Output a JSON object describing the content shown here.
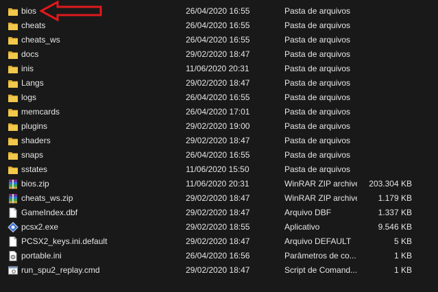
{
  "files": [
    {
      "name": "bios",
      "date": "26/04/2020 16:55",
      "type": "Pasta de arquivos",
      "size": "",
      "icon": "folder-icon"
    },
    {
      "name": "cheats",
      "date": "26/04/2020 16:55",
      "type": "Pasta de arquivos",
      "size": "",
      "icon": "folder-icon"
    },
    {
      "name": "cheats_ws",
      "date": "26/04/2020 16:55",
      "type": "Pasta de arquivos",
      "size": "",
      "icon": "folder-icon"
    },
    {
      "name": "docs",
      "date": "29/02/2020 18:47",
      "type": "Pasta de arquivos",
      "size": "",
      "icon": "folder-icon"
    },
    {
      "name": "inis",
      "date": "11/06/2020 20:31",
      "type": "Pasta de arquivos",
      "size": "",
      "icon": "folder-icon"
    },
    {
      "name": "Langs",
      "date": "29/02/2020 18:47",
      "type": "Pasta de arquivos",
      "size": "",
      "icon": "folder-icon"
    },
    {
      "name": "logs",
      "date": "26/04/2020 16:55",
      "type": "Pasta de arquivos",
      "size": "",
      "icon": "folder-icon"
    },
    {
      "name": "memcards",
      "date": "26/04/2020 17:01",
      "type": "Pasta de arquivos",
      "size": "",
      "icon": "folder-icon"
    },
    {
      "name": "plugins",
      "date": "29/02/2020 19:00",
      "type": "Pasta de arquivos",
      "size": "",
      "icon": "folder-icon"
    },
    {
      "name": "shaders",
      "date": "29/02/2020 18:47",
      "type": "Pasta de arquivos",
      "size": "",
      "icon": "folder-icon"
    },
    {
      "name": "snaps",
      "date": "26/04/2020 16:55",
      "type": "Pasta de arquivos",
      "size": "",
      "icon": "folder-icon"
    },
    {
      "name": "sstates",
      "date": "11/06/2020 15:50",
      "type": "Pasta de arquivos",
      "size": "",
      "icon": "folder-icon"
    },
    {
      "name": "bios.zip",
      "date": "11/06/2020 20:31",
      "type": "WinRAR ZIP archive",
      "size": "203.304 KB",
      "icon": "winrar-zip-icon"
    },
    {
      "name": "cheats_ws.zip",
      "date": "29/02/2020 18:47",
      "type": "WinRAR ZIP archive",
      "size": "1.179 KB",
      "icon": "winrar-zip-icon"
    },
    {
      "name": "GameIndex.dbf",
      "date": "29/02/2020 18:47",
      "type": "Arquivo DBF",
      "size": "1.337 KB",
      "icon": "file-icon"
    },
    {
      "name": "pcsx2.exe",
      "date": "29/02/2020 18:55",
      "type": "Aplicativo",
      "size": "9.546 KB",
      "icon": "exe-icon"
    },
    {
      "name": "PCSX2_keys.ini.default",
      "date": "29/02/2020 18:47",
      "type": "Arquivo DEFAULT",
      "size": "5 KB",
      "icon": "file-icon"
    },
    {
      "name": "portable.ini",
      "date": "26/04/2020 16:56",
      "type": "Parâmetros de co...",
      "size": "1 KB",
      "icon": "settings-file-icon"
    },
    {
      "name": "run_spu2_replay.cmd",
      "date": "29/02/2020 18:47",
      "type": "Script de Comand...",
      "size": "1 KB",
      "icon": "cmd-icon"
    }
  ],
  "colors": {
    "background": "#191919",
    "text": "#e6e6e6",
    "folder": "#f2c84b",
    "arrow": "#e0191b"
  }
}
